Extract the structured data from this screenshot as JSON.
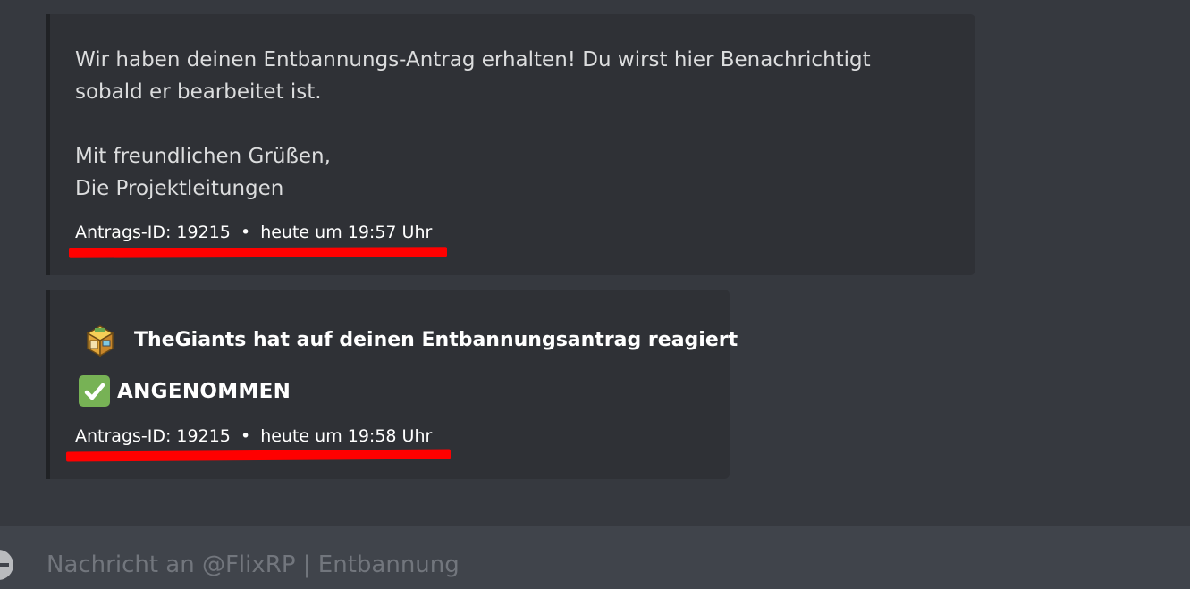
{
  "messages": [
    {
      "description_lines": [
        "Wir haben deinen Entbannungs-Antrag erhalten! Du wirst hier Benachrichtigt",
        "sobald er bearbeitet ist."
      ],
      "signature_lines": [
        "Mit freundlichen Grüßen,",
        "Die Projektleitungen"
      ],
      "footer": {
        "id_text": "Antrags-ID: 19215",
        "separator": "•",
        "timestamp": "heute um 19:57 Uhr"
      }
    },
    {
      "author": {
        "icon": "shop-avatar-icon",
        "name": "TheGiants hat auf deinen Entbannungsantrag reagiert"
      },
      "status": {
        "icon": "check-mark-icon",
        "label": "ANGENOMMEN"
      },
      "footer": {
        "id_text": "Antrags-ID: 19215",
        "separator": "•",
        "timestamp": "heute um 19:58 Uhr"
      }
    }
  ],
  "composer": {
    "placeholder": "Nachricht an @FlixRP | Entbannung",
    "attach_icon": "plus-circle-icon"
  },
  "colors": {
    "background": "#36393f",
    "embed_background": "#2f3136",
    "embed_border": "#202225",
    "input_background": "#40444b",
    "highlight_underline": "#ff0000",
    "check_green": "#77b255"
  }
}
